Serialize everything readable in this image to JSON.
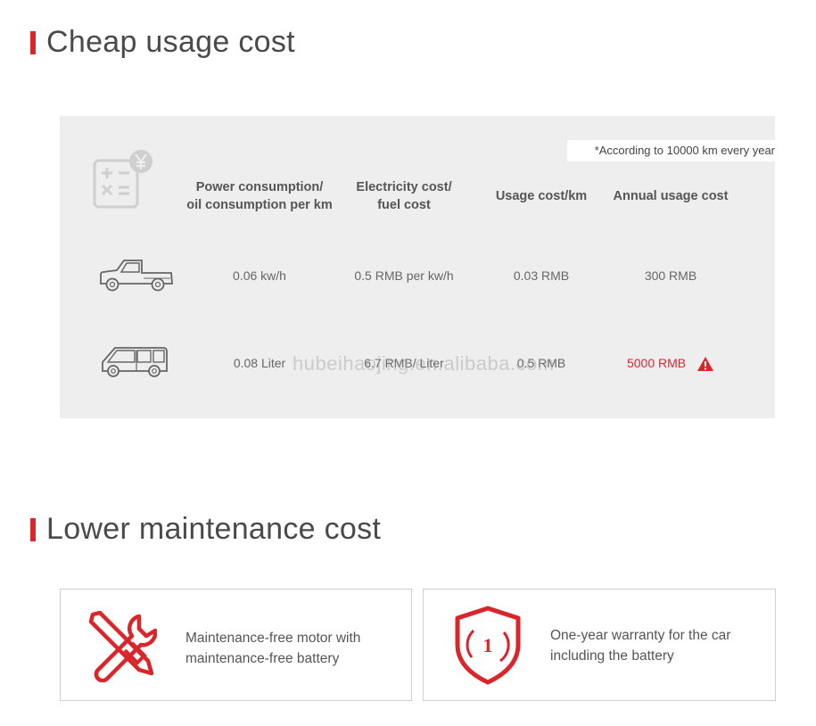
{
  "section1": {
    "title": "Cheap usage cost"
  },
  "note": "*According to 10000 km every year",
  "table": {
    "headers": [
      "Power consumption/\noil consumption per km",
      "Electricity cost/\nfuel cost",
      "Usage cost/km",
      "Annual usage cost"
    ],
    "rows": [
      {
        "vehicle_icon": "pickup-truck-icon",
        "values": [
          "0.06 kw/h",
          "0.5 RMB per kw/h",
          "0.03 RMB",
          "300 RMB"
        ]
      },
      {
        "vehicle_icon": "van-icon",
        "values": [
          "0.08 Liter",
          "6.7 RMB/ Liter",
          "0.5 RMB",
          "5000 RMB"
        ],
        "warning_icon": "warning-icon"
      }
    ],
    "header_icon": "calculator-yuan-icon"
  },
  "watermark": "hubeihaojing.en.alibaba.com",
  "section2": {
    "title": "Lower maintenance cost"
  },
  "cards": [
    {
      "icon": "wrench-screwdriver-icon",
      "line1": "Maintenance-free motor with",
      "line2": "maintenance-free battery"
    },
    {
      "icon": "shield-one-icon",
      "line1": "One-year warranty for the car",
      "line2": "including the battery"
    }
  ],
  "colors": {
    "accent": "#d9262b",
    "panel": "#eeeeee",
    "text": "#555555"
  }
}
